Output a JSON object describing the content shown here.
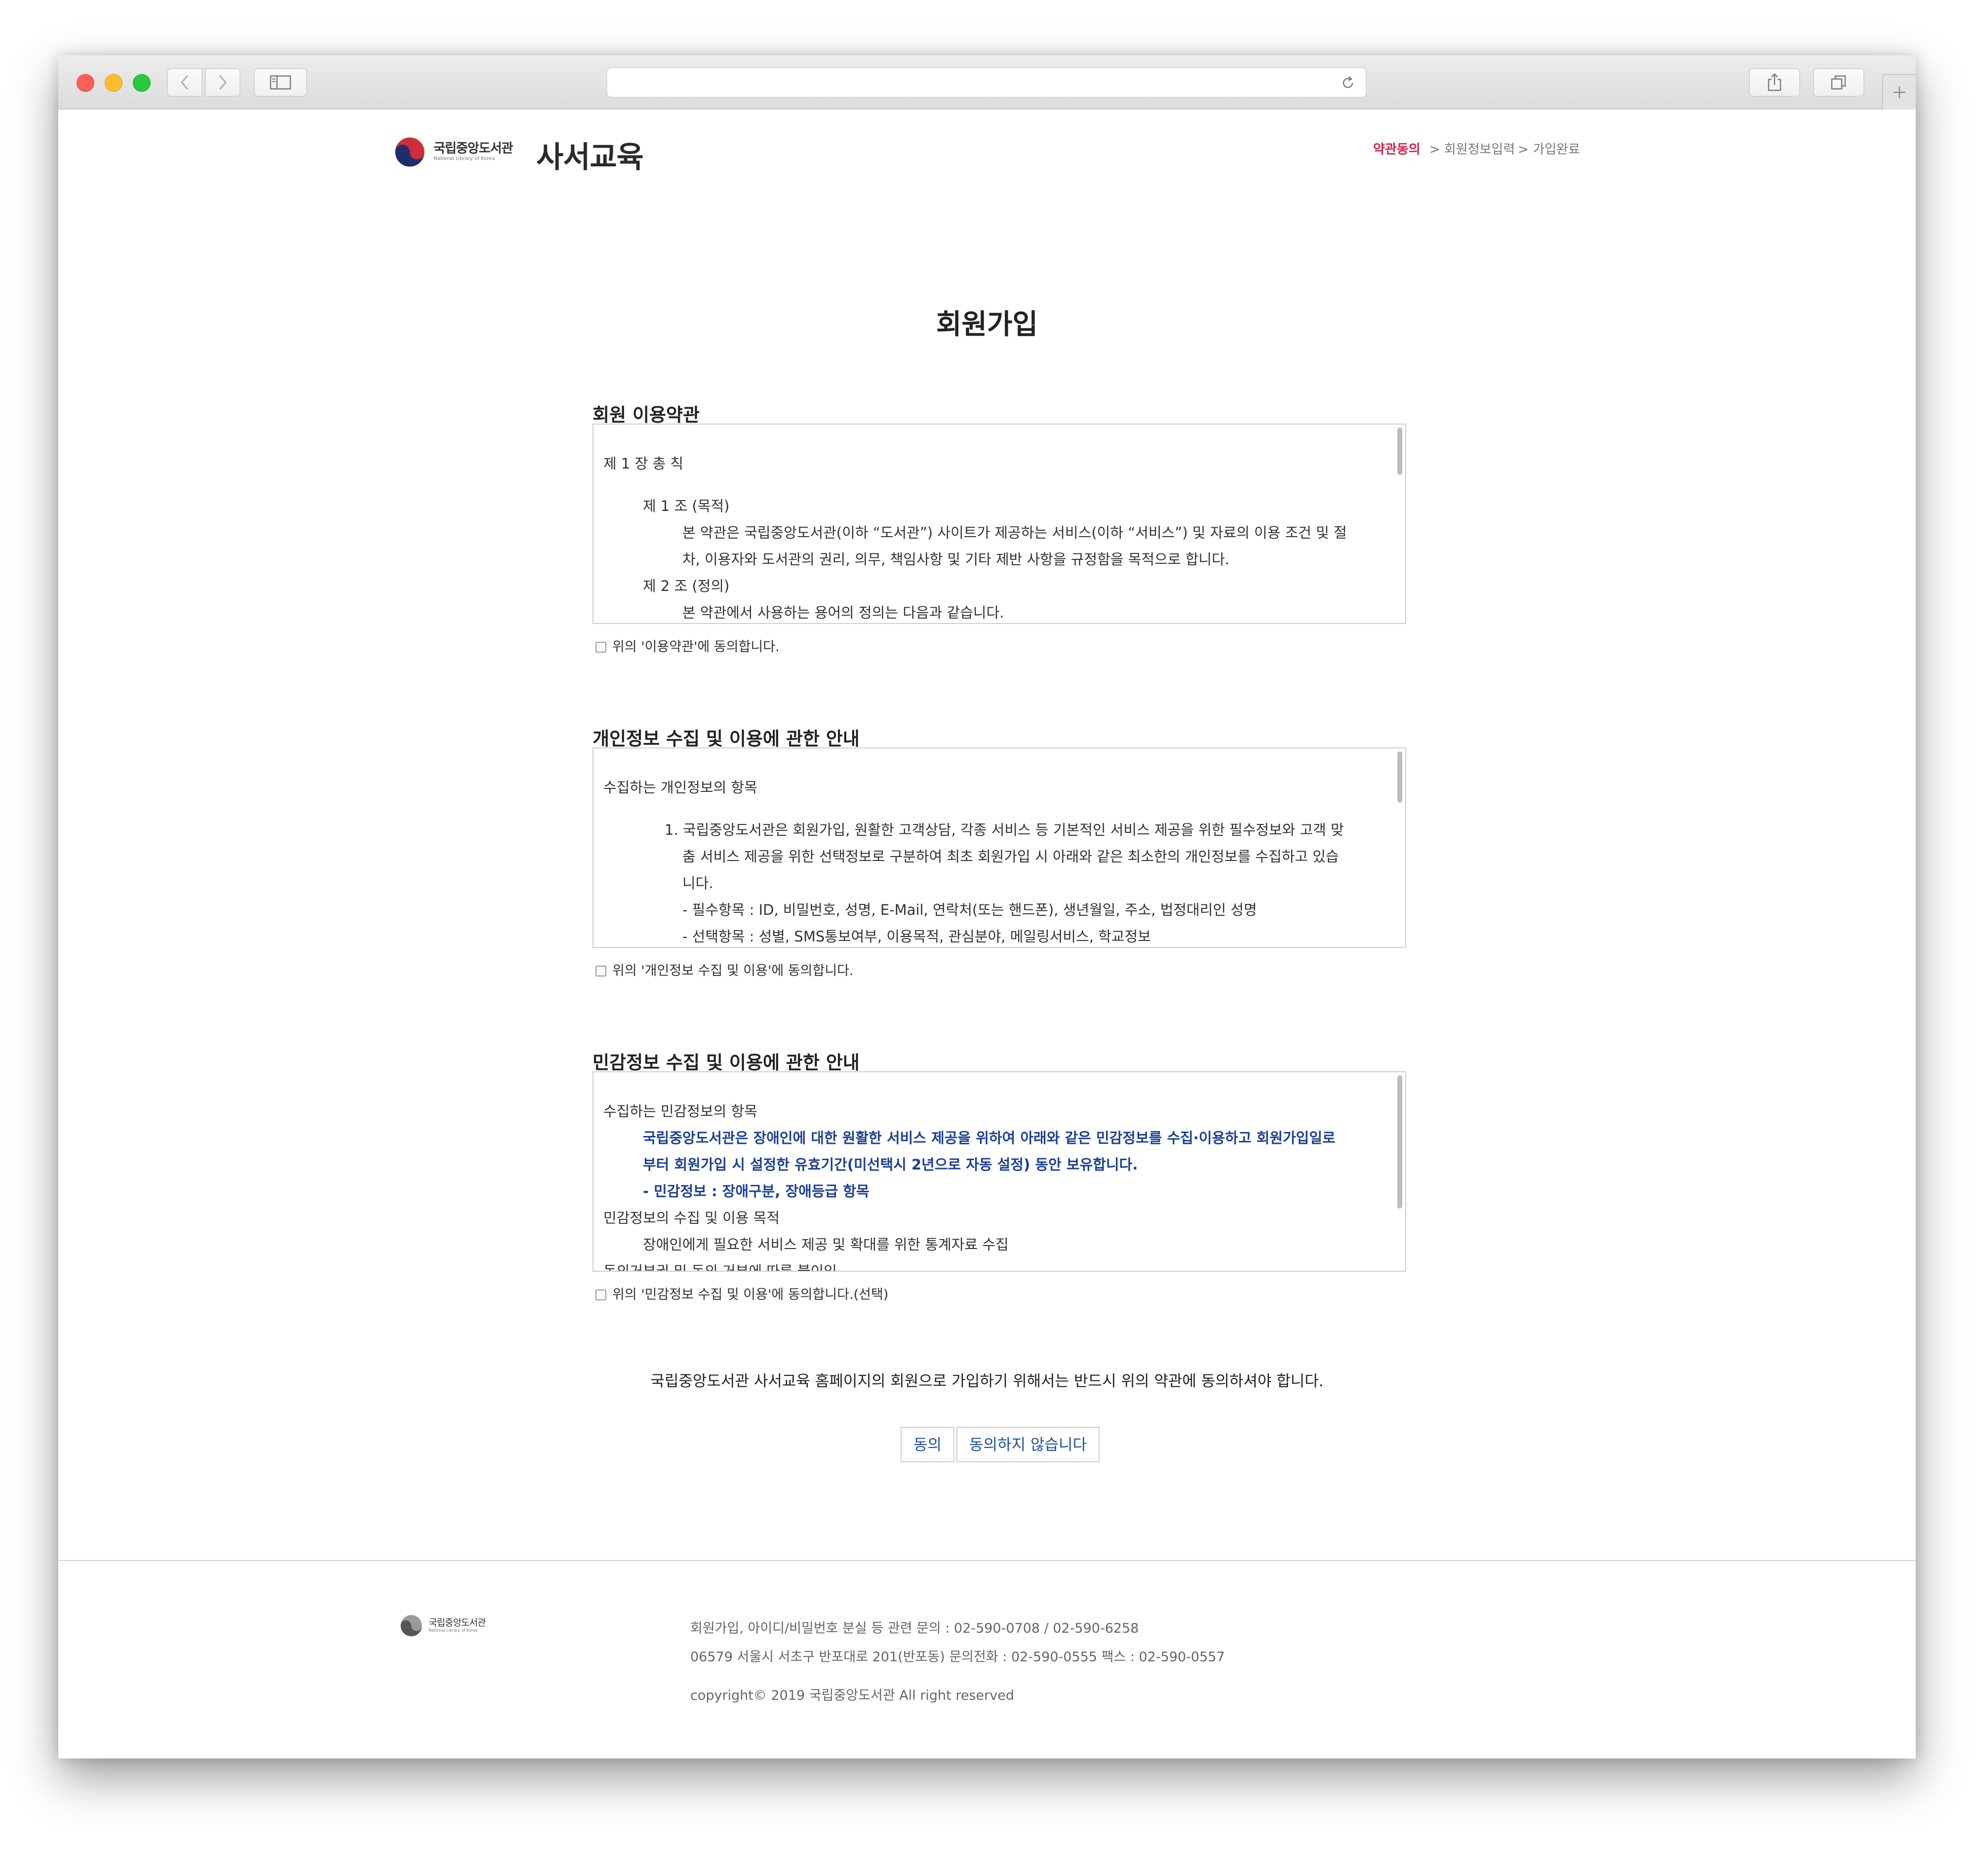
{
  "site": {
    "logo_ko": "국립중앙도서관",
    "logo_en": "National Library of Korea",
    "title": "사서교육"
  },
  "steps": {
    "current": "약관동의",
    "next1": "> 회원정보입력",
    "next2": "> 가입완료"
  },
  "page_title": "회원가입",
  "sections": [
    {
      "title": "회원 이용약관",
      "lines": [
        "제 1 장 총 칙",
        "제 1 조 (목적)",
        "본 약관은 국립중앙도서관(이하 “도서관”) 사이트가 제공하는 서비스(이하 “서비스”) 및 자료의 이용 조건 및 절",
        "차, 이용자와 도서관의 권리, 의무, 책임사항 및 기타 제반 사항을 규정함을 목적으로 합니다.",
        "제 2 조 (정의)",
        "본 약관에서 사용하는 용어의 정의는 다음과 같습니다."
      ],
      "agree": "위의 '이용약관'에 동의합니다."
    },
    {
      "title": "개인정보 수집 및 이용에 관한 안내",
      "lines": [
        "수집하는 개인정보의 항목",
        "1. 국립중앙도서관은 회원가입, 원활한 고객상담, 각종 서비스 등 기본적인 서비스 제공을 위한 필수정보와 고객 맞",
        "춤 서비스 제공을 위한 선택정보로 구분하여 최초 회원가입 시 아래와 같은 최소한의 개인정보를 수집하고 있습",
        "니다.",
        "- 필수항목 : ID, 비밀번호, 성명, E-Mail, 연락처(또는 핸드폰), 생년월일, 주소, 법정대리인 성명",
        "- 선택항목 : 성별, SMS통보여부, 이용목적, 관심분야, 메일링서비스, 학교정보"
      ],
      "agree": "위의 '개인정보 수집 및 이용'에 동의합니다."
    },
    {
      "title": "민감정보 수집 및 이용에 관한 안내",
      "lines": [
        "수집하는 민감정보의 항목",
        "국립중앙도서관은 장애인에 대한 원활한 서비스 제공을 위하여 아래와 같은 민감정보를 수집·이용하고 회원가입일로",
        "부터 회원가입 시 설정한 유효기간(미선택시 2년으로 자동 설정) 동안 보유합니다.",
        "- 민감정보 : 장애구분, 장애등급 항목",
        "민감정보의 수집 및 이용 목적",
        "장애인에게 필요한 서비스 제공 및 확대를 위한 통계자료 수집",
        "동의거부권 및 동의 거부에 따른 불이익"
      ],
      "agree": "위의 '민감정보 수집 및 이용'에 동의합니다.(선택)"
    }
  ],
  "notice": "국립중앙도서관 사서교육 홈페이지의 회원으로 가입하기 위해서는 반드시 위의 약관에 동의하셔야 합니다.",
  "buttons": {
    "agree": "동의",
    "disagree": "동의하지 않습니다"
  },
  "footer": {
    "logo_ko": "국립중앙도서관",
    "logo_en": "National Library of Korea",
    "contact": "회원가입, 아이디/비밀번호 분실 등 관련 문의 : 02-590-0708 / 02-590-6258",
    "address": "06579 서울시 서초구 반포대로 201(반포동) 문의전화 : 02-590-0555 팩스 : 02-590-0557",
    "copyright": "copyright© 2019 국립중앙도서관 All right reserved"
  },
  "colors": {
    "accent_step": "#d0214a",
    "button_text": "#1c4fa0",
    "highlight_text": "#1c3f94"
  },
  "icons": [
    "back-icon",
    "forward-icon",
    "sidebar-icon",
    "reload-icon",
    "share-icon",
    "tabs-icon",
    "plus-icon",
    "library-logo-icon"
  ]
}
